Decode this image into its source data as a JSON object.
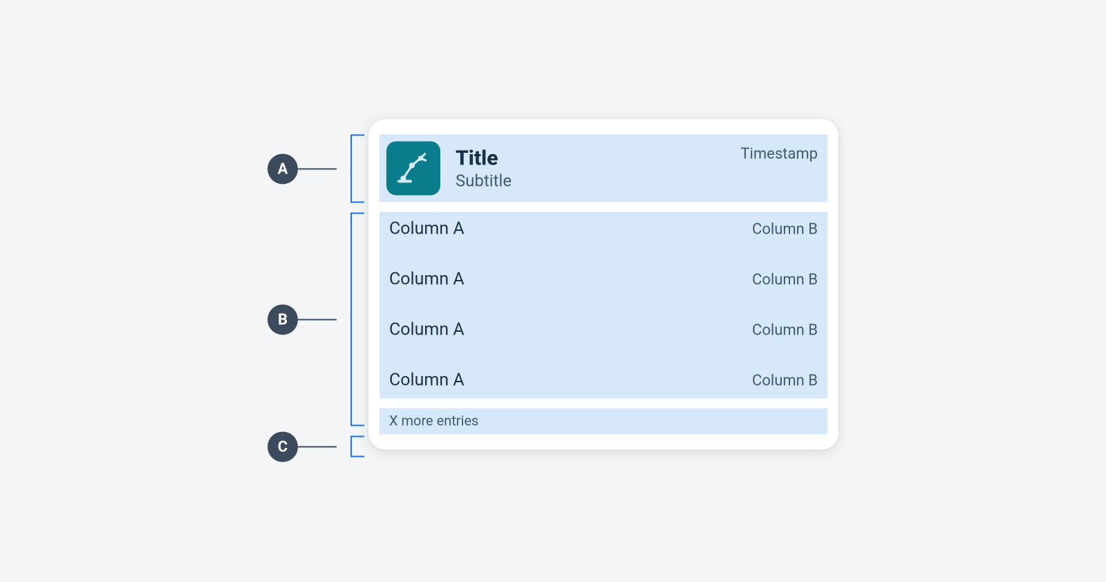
{
  "annotations": {
    "a": "A",
    "b": "B",
    "c": "C"
  },
  "header": {
    "title": "Title",
    "subtitle": "Subtitle",
    "timestamp": "Timestamp",
    "icon_name": "robot-arm-icon"
  },
  "rows": [
    {
      "a": "Column A",
      "b": "Column B"
    },
    {
      "a": "Column A",
      "b": "Column B"
    },
    {
      "a": "Column A",
      "b": "Column B"
    },
    {
      "a": "Column A",
      "b": "Column B"
    }
  ],
  "footer": {
    "more": "X more entries"
  }
}
